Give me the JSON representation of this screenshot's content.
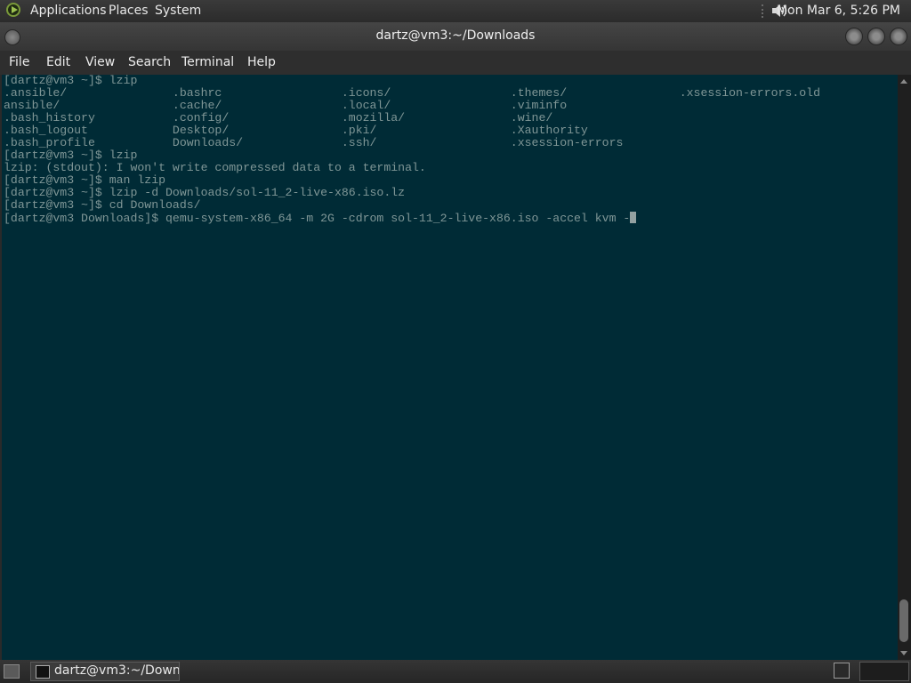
{
  "top_panel": {
    "menus": [
      "Applications",
      "Places",
      "System"
    ],
    "clock": "Mon Mar  6,  5:26 PM",
    "icons": [
      "gnome-foot-icon",
      "volume-icon"
    ]
  },
  "window": {
    "title": "dartz@vm3:~/Downloads"
  },
  "menubar": {
    "items": [
      "File",
      "Edit",
      "View",
      "Search",
      "Terminal",
      "Help"
    ]
  },
  "terminal": {
    "background": "#002b36",
    "foreground": "#839496",
    "lines": [
      "[dartz@vm3 ~]$ lzip",
      ".ansible/               .bashrc                 .icons/                 .themes/                .xsession-errors.old",
      "ansible/                .cache/                 .local/                 .viminfo",
      ".bash_history           .config/                .mozilla/               .wine/",
      ".bash_logout            Desktop/                .pki/                   .Xauthority",
      ".bash_profile           Downloads/              .ssh/                   .xsession-errors",
      "[dartz@vm3 ~]$ lzip",
      "lzip: (stdout): I won't write compressed data to a terminal.",
      "[dartz@vm3 ~]$ man lzip",
      "[dartz@vm3 ~]$ lzip -d Downloads/sol-11_2-live-x86.iso.lz",
      "[dartz@vm3 ~]$ cd Downloads/",
      "[dartz@vm3 Downloads]$ qemu-system-x86_64 -m 2G -cdrom sol-11_2-live-x86.iso -accel kvm -"
    ]
  },
  "taskbar": {
    "task_label": "dartz@vm3:~/Down...",
    "icons": [
      "show-desktop-icon",
      "terminal-icon",
      "workspace-switcher"
    ]
  }
}
